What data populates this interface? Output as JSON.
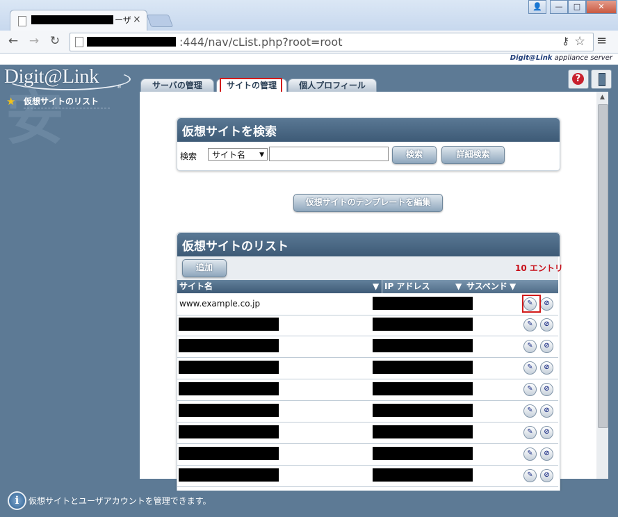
{
  "browser": {
    "tab_title_suffix": "ーザ",
    "tab_close": "×",
    "url_visible": ":444/nav/cList.php?root=root",
    "window_buttons": {
      "user": "👤",
      "minimize": "—",
      "maximize": "□",
      "close": "✕"
    }
  },
  "header": {
    "appliance_brand": "Digit@Link",
    "appliance_label": "appliance server"
  },
  "logo": {
    "text": "Digit@Link",
    "registered": "®"
  },
  "sidebar": {
    "items": [
      {
        "label": "仮想サイトのリスト"
      }
    ]
  },
  "tabs": [
    {
      "label": "サーバの管理"
    },
    {
      "label": "サイトの管理"
    },
    {
      "label": "個人プロフィール"
    }
  ],
  "search_panel": {
    "title": "仮想サイトを検索",
    "label": "検索",
    "select_value": "サイト名",
    "input_value": "",
    "search_button": "検索",
    "advanced_button": "詳細検索"
  },
  "template_button": "仮想サイトのテンプレートを編集",
  "list_panel": {
    "title": "仮想サイトのリスト",
    "add_button": "追加",
    "entries_count": "10 エントリ",
    "columns": [
      "サイト名",
      "IP アドレス",
      "サスペンド"
    ],
    "rows": [
      {
        "site_name": "www.example.co.jp"
      },
      {
        "site_name": ""
      },
      {
        "site_name": ""
      },
      {
        "site_name": ""
      },
      {
        "site_name": ""
      },
      {
        "site_name": ""
      },
      {
        "site_name": ""
      },
      {
        "site_name": ""
      },
      {
        "site_name": ""
      }
    ]
  },
  "status_bar": {
    "text": "仮想サイトとユーザアカウントを管理できます。",
    "icon": "i"
  },
  "colors": {
    "accent_red": "#d21b1b",
    "header_blue": "#3d5a76",
    "entries_red": "#c8101a"
  }
}
